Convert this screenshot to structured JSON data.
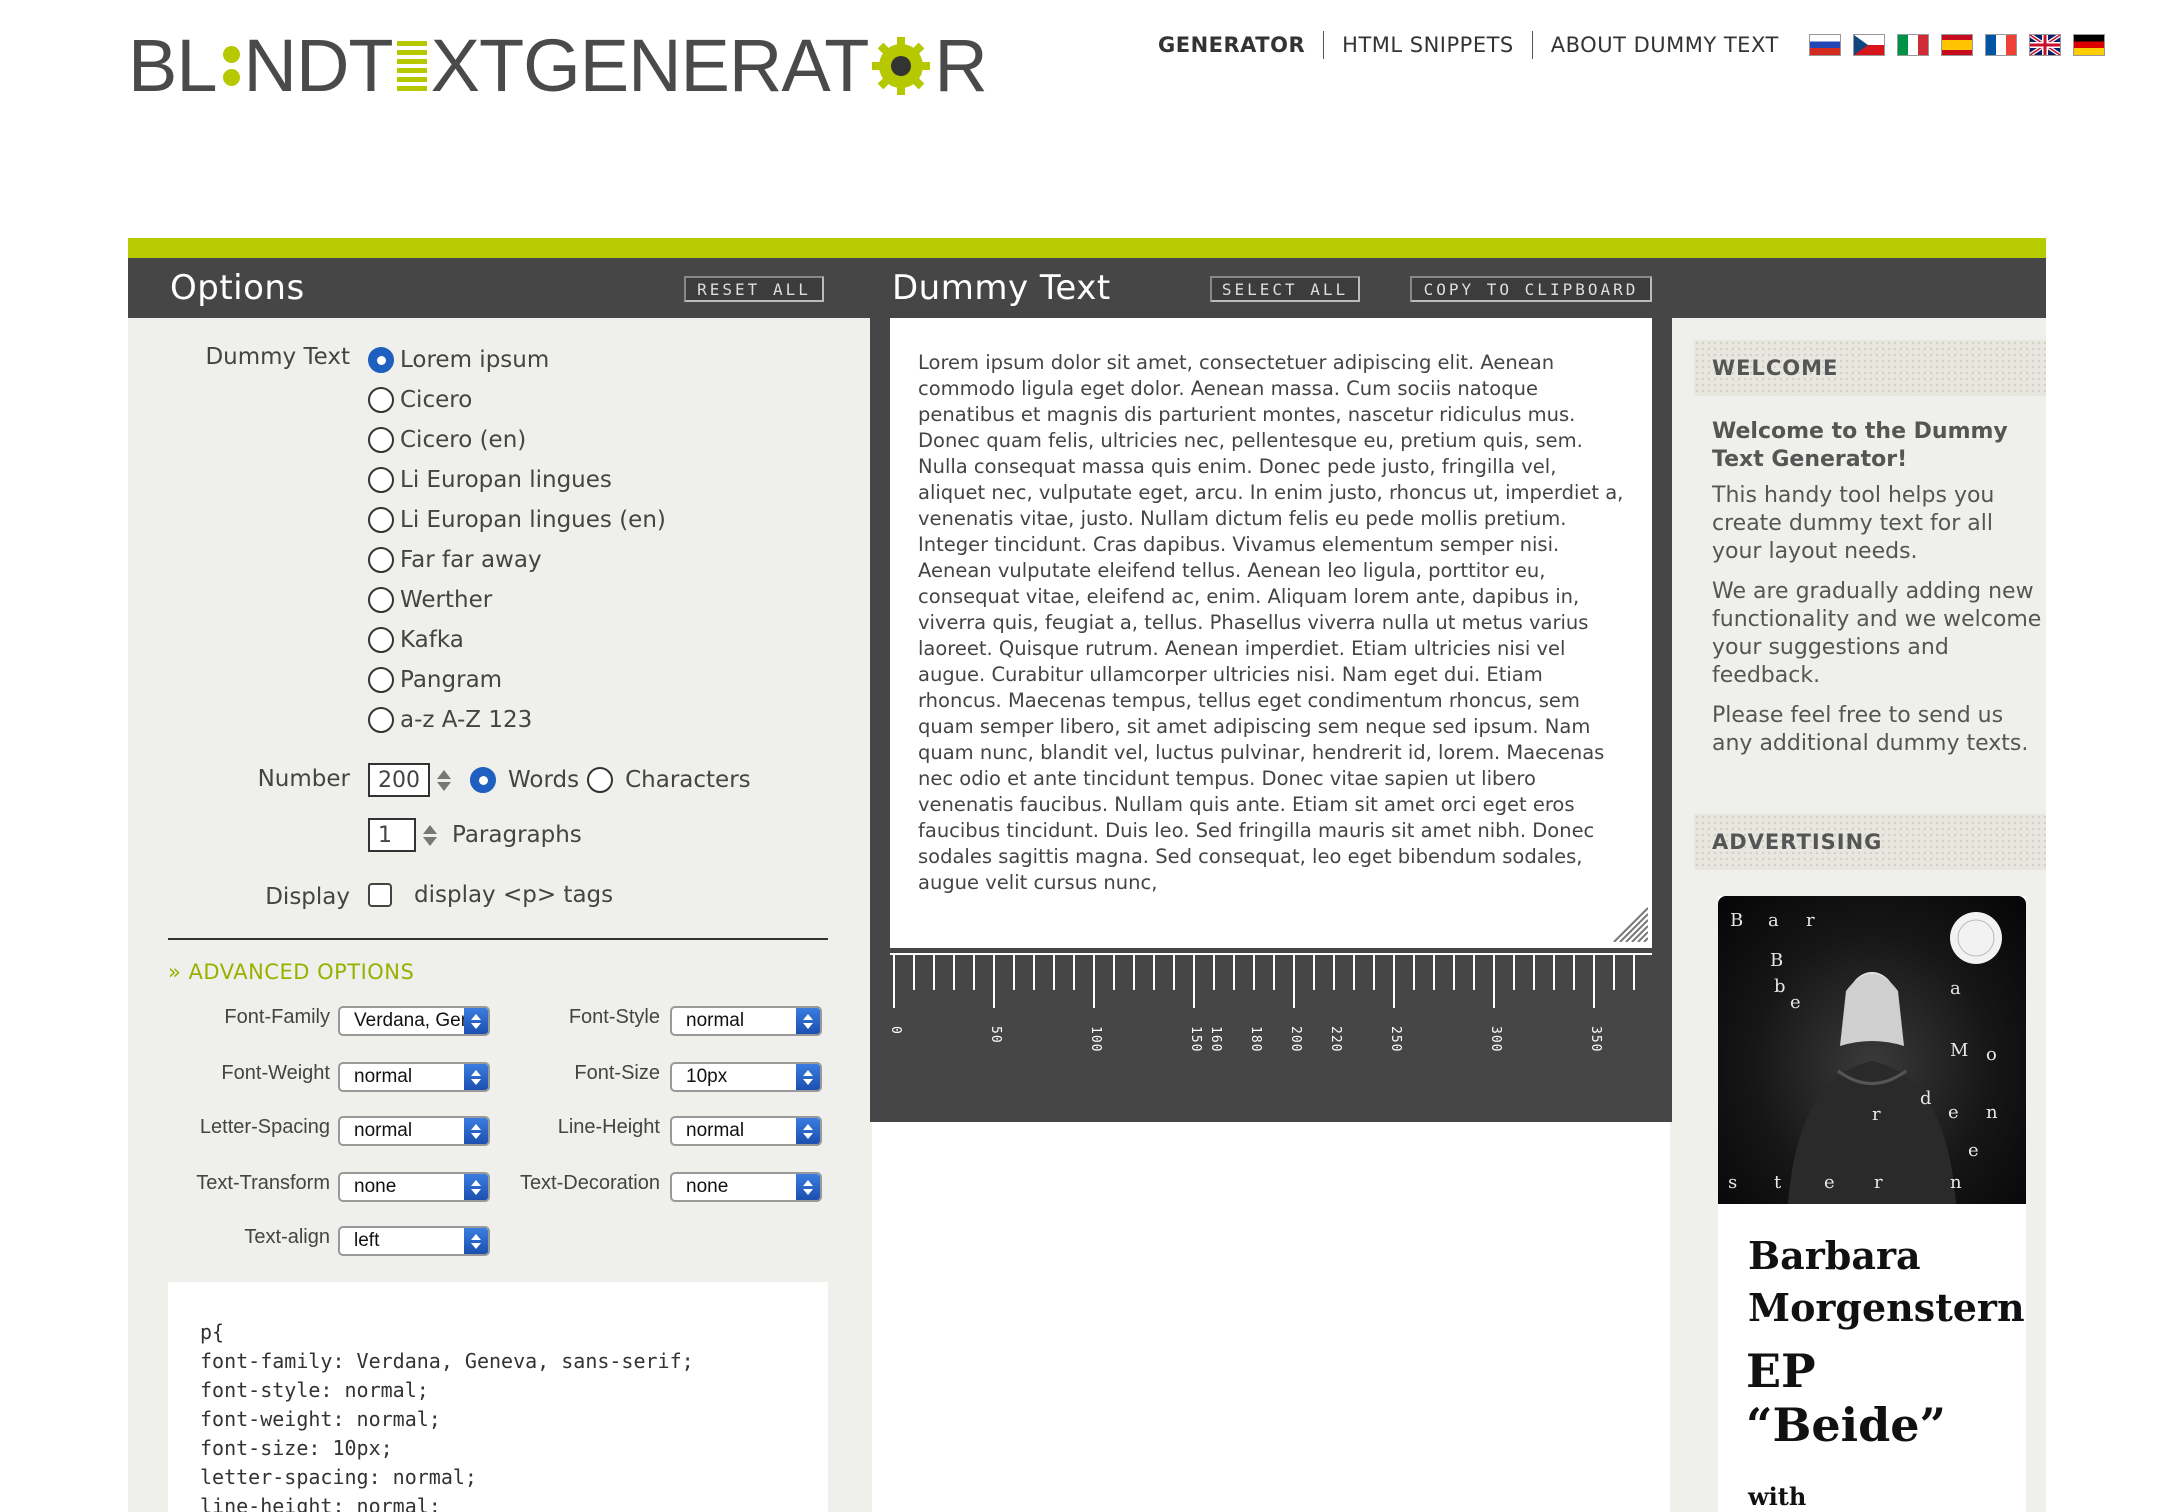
{
  "logo": {
    "parts": [
      "BL",
      "NDT",
      "XTGENERAT",
      "R"
    ]
  },
  "nav": {
    "items": [
      {
        "label": "GENERATOR",
        "active": true
      },
      {
        "label": "HTML SNIPPETS",
        "active": false
      },
      {
        "label": "ABOUT DUMMY TEXT",
        "active": false
      }
    ],
    "flags": [
      "russian-flag-icon",
      "czech-flag-icon",
      "italian-flag-icon",
      "spanish-flag-icon",
      "french-flag-icon",
      "british-flag-icon",
      "german-flag-icon"
    ]
  },
  "options": {
    "title": "Options",
    "reset_label": "RESET ALL",
    "dummy_text_label": "Dummy Text",
    "dummy_text_options": [
      "Lorem ipsum",
      "Cicero",
      "Cicero (en)",
      "Li Europan lingues",
      "Li Europan lingues (en)",
      "Far far away",
      "Werther",
      "Kafka",
      "Pangram",
      "a-z A-Z 123"
    ],
    "dummy_text_selected": "Lorem ipsum",
    "number_label": "Number",
    "number_value": "200",
    "unit_words": "Words",
    "unit_characters": "Characters",
    "unit_selected": "Words",
    "paragraphs_value": "1",
    "paragraphs_label": "Paragraphs",
    "display_label": "Display",
    "display_p_label": "display <p> tags",
    "display_p_checked": false,
    "advanced_label": "» ADVANCED OPTIONS"
  },
  "advanced": {
    "font_family": {
      "label": "Font-Family",
      "value": "Verdana, Geneva, sans-serif"
    },
    "font_style": {
      "label": "Font-Style",
      "value": "normal"
    },
    "font_weight": {
      "label": "Font-Weight",
      "value": "normal"
    },
    "font_size": {
      "label": "Font-Size",
      "value": "10px"
    },
    "letter_spacing": {
      "label": "Letter-Spacing",
      "value": "normal"
    },
    "line_height": {
      "label": "Line-Height",
      "value": "normal"
    },
    "text_transform": {
      "label": "Text-Transform",
      "value": "none"
    },
    "text_decoration": {
      "label": "Text-Decoration",
      "value": "none"
    },
    "text_align": {
      "label": "Text-align",
      "value": "left"
    }
  },
  "css_code": "p{\nfont-family: Verdana, Geneva, sans-serif;\nfont-style: normal;\nfont-weight: normal;\nfont-size: 10px;\nletter-spacing: normal;\nline-height: normal;",
  "dummy": {
    "title": "Dummy Text",
    "select_all_label": "SELECT ALL",
    "copy_label": "COPY TO CLIPBOARD",
    "text": "Lorem ipsum dolor sit amet, consectetuer adipiscing elit. Aenean commodo ligula eget dolor. Aenean massa. Cum sociis natoque penatibus et magnis dis parturient montes, nascetur ridiculus mus. Donec quam felis, ultricies nec, pellentesque eu, pretium quis, sem. Nulla consequat massa quis enim. Donec pede justo, fringilla vel, aliquet nec, vulputate eget, arcu. In enim justo, rhoncus ut, imperdiet a, venenatis vitae, justo. Nullam dictum felis eu pede mollis pretium. Integer tincidunt. Cras dapibus. Vivamus elementum semper nisi. Aenean vulputate eleifend tellus. Aenean leo ligula, porttitor eu, consequat vitae, eleifend ac, enim. Aliquam lorem ante, dapibus in, viverra quis, feugiat a, tellus. Phasellus viverra nulla ut metus varius laoreet. Quisque rutrum. Aenean imperdiet. Etiam ultricies nisi vel augue. Curabitur ullamcorper ultricies nisi. Nam eget dui. Etiam rhoncus. Maecenas tempus, tellus eget condimentum rhoncus, sem quam semper libero, sit amet adipiscing sem neque sed ipsum. Nam quam nunc, blandit vel, luctus pulvinar, hendrerit id, lorem. Maecenas nec odio et ante tincidunt tempus. Donec vitae sapien ut libero venenatis faucibus. Nullam quis ante. Etiam sit amet orci eget eros faucibus tincidunt. Duis leo. Sed fringilla mauris sit amet nibh. Donec sodales sagittis magna. Sed consequat, leo eget bibendum sodales, augue velit cursus nunc,",
    "ruler_labels": [
      "0",
      "50",
      "100",
      "150",
      "160",
      "180",
      "200",
      "220",
      "250",
      "300",
      "350"
    ]
  },
  "sidebar": {
    "welcome_heading": "WELCOME",
    "welcome_title": "Welcome to the Dummy Text Generator!",
    "welcome_p1": "This handy tool helps you create dummy text for all your layout needs.",
    "welcome_p2": "We are gradually adding new functionality and we welcome your suggestions and feedback.",
    "welcome_p3": "Please feel free to send us any additional dummy texts.",
    "advertising_heading": "ADVERTISING",
    "ad": {
      "title_line1": "Barbara",
      "title_line2": "Morgenstern",
      "subtitle": "EP “Beide”",
      "with": "with"
    }
  },
  "colors": {
    "accent": "#b6cb00",
    "dark": "#464646",
    "panel": "#efefeb",
    "radio_on": "#1f5fbf"
  }
}
